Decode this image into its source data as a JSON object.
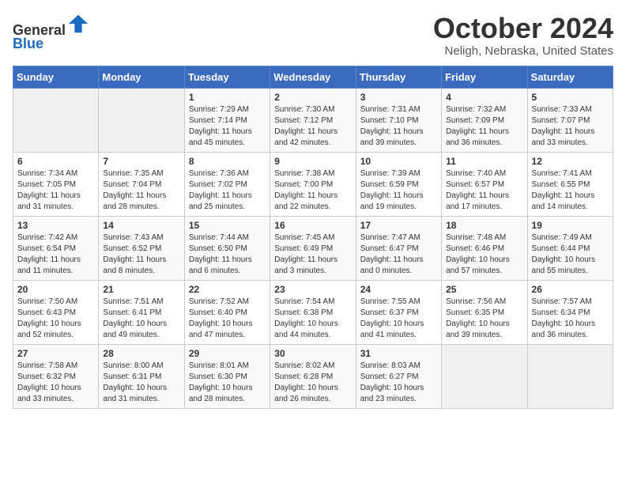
{
  "header": {
    "logo": {
      "line1": "General",
      "line2": "Blue"
    },
    "title": "October 2024",
    "location": "Neligh, Nebraska, United States"
  },
  "weekdays": [
    "Sunday",
    "Monday",
    "Tuesday",
    "Wednesday",
    "Thursday",
    "Friday",
    "Saturday"
  ],
  "weeks": [
    [
      {
        "day": "",
        "empty": true
      },
      {
        "day": "",
        "empty": true
      },
      {
        "day": "1",
        "sunrise": "Sunrise: 7:29 AM",
        "sunset": "Sunset: 7:14 PM",
        "daylight": "Daylight: 11 hours and 45 minutes."
      },
      {
        "day": "2",
        "sunrise": "Sunrise: 7:30 AM",
        "sunset": "Sunset: 7:12 PM",
        "daylight": "Daylight: 11 hours and 42 minutes."
      },
      {
        "day": "3",
        "sunrise": "Sunrise: 7:31 AM",
        "sunset": "Sunset: 7:10 PM",
        "daylight": "Daylight: 11 hours and 39 minutes."
      },
      {
        "day": "4",
        "sunrise": "Sunrise: 7:32 AM",
        "sunset": "Sunset: 7:09 PM",
        "daylight": "Daylight: 11 hours and 36 minutes."
      },
      {
        "day": "5",
        "sunrise": "Sunrise: 7:33 AM",
        "sunset": "Sunset: 7:07 PM",
        "daylight": "Daylight: 11 hours and 33 minutes."
      }
    ],
    [
      {
        "day": "6",
        "sunrise": "Sunrise: 7:34 AM",
        "sunset": "Sunset: 7:05 PM",
        "daylight": "Daylight: 11 hours and 31 minutes."
      },
      {
        "day": "7",
        "sunrise": "Sunrise: 7:35 AM",
        "sunset": "Sunset: 7:04 PM",
        "daylight": "Daylight: 11 hours and 28 minutes."
      },
      {
        "day": "8",
        "sunrise": "Sunrise: 7:36 AM",
        "sunset": "Sunset: 7:02 PM",
        "daylight": "Daylight: 11 hours and 25 minutes."
      },
      {
        "day": "9",
        "sunrise": "Sunrise: 7:38 AM",
        "sunset": "Sunset: 7:00 PM",
        "daylight": "Daylight: 11 hours and 22 minutes."
      },
      {
        "day": "10",
        "sunrise": "Sunrise: 7:39 AM",
        "sunset": "Sunset: 6:59 PM",
        "daylight": "Daylight: 11 hours and 19 minutes."
      },
      {
        "day": "11",
        "sunrise": "Sunrise: 7:40 AM",
        "sunset": "Sunset: 6:57 PM",
        "daylight": "Daylight: 11 hours and 17 minutes."
      },
      {
        "day": "12",
        "sunrise": "Sunrise: 7:41 AM",
        "sunset": "Sunset: 6:55 PM",
        "daylight": "Daylight: 11 hours and 14 minutes."
      }
    ],
    [
      {
        "day": "13",
        "sunrise": "Sunrise: 7:42 AM",
        "sunset": "Sunset: 6:54 PM",
        "daylight": "Daylight: 11 hours and 11 minutes."
      },
      {
        "day": "14",
        "sunrise": "Sunrise: 7:43 AM",
        "sunset": "Sunset: 6:52 PM",
        "daylight": "Daylight: 11 hours and 8 minutes."
      },
      {
        "day": "15",
        "sunrise": "Sunrise: 7:44 AM",
        "sunset": "Sunset: 6:50 PM",
        "daylight": "Daylight: 11 hours and 6 minutes."
      },
      {
        "day": "16",
        "sunrise": "Sunrise: 7:45 AM",
        "sunset": "Sunset: 6:49 PM",
        "daylight": "Daylight: 11 hours and 3 minutes."
      },
      {
        "day": "17",
        "sunrise": "Sunrise: 7:47 AM",
        "sunset": "Sunset: 6:47 PM",
        "daylight": "Daylight: 11 hours and 0 minutes."
      },
      {
        "day": "18",
        "sunrise": "Sunrise: 7:48 AM",
        "sunset": "Sunset: 6:46 PM",
        "daylight": "Daylight: 10 hours and 57 minutes."
      },
      {
        "day": "19",
        "sunrise": "Sunrise: 7:49 AM",
        "sunset": "Sunset: 6:44 PM",
        "daylight": "Daylight: 10 hours and 55 minutes."
      }
    ],
    [
      {
        "day": "20",
        "sunrise": "Sunrise: 7:50 AM",
        "sunset": "Sunset: 6:43 PM",
        "daylight": "Daylight: 10 hours and 52 minutes."
      },
      {
        "day": "21",
        "sunrise": "Sunrise: 7:51 AM",
        "sunset": "Sunset: 6:41 PM",
        "daylight": "Daylight: 10 hours and 49 minutes."
      },
      {
        "day": "22",
        "sunrise": "Sunrise: 7:52 AM",
        "sunset": "Sunset: 6:40 PM",
        "daylight": "Daylight: 10 hours and 47 minutes."
      },
      {
        "day": "23",
        "sunrise": "Sunrise: 7:54 AM",
        "sunset": "Sunset: 6:38 PM",
        "daylight": "Daylight: 10 hours and 44 minutes."
      },
      {
        "day": "24",
        "sunrise": "Sunrise: 7:55 AM",
        "sunset": "Sunset: 6:37 PM",
        "daylight": "Daylight: 10 hours and 41 minutes."
      },
      {
        "day": "25",
        "sunrise": "Sunrise: 7:56 AM",
        "sunset": "Sunset: 6:35 PM",
        "daylight": "Daylight: 10 hours and 39 minutes."
      },
      {
        "day": "26",
        "sunrise": "Sunrise: 7:57 AM",
        "sunset": "Sunset: 6:34 PM",
        "daylight": "Daylight: 10 hours and 36 minutes."
      }
    ],
    [
      {
        "day": "27",
        "sunrise": "Sunrise: 7:58 AM",
        "sunset": "Sunset: 6:32 PM",
        "daylight": "Daylight: 10 hours and 33 minutes."
      },
      {
        "day": "28",
        "sunrise": "Sunrise: 8:00 AM",
        "sunset": "Sunset: 6:31 PM",
        "daylight": "Daylight: 10 hours and 31 minutes."
      },
      {
        "day": "29",
        "sunrise": "Sunrise: 8:01 AM",
        "sunset": "Sunset: 6:30 PM",
        "daylight": "Daylight: 10 hours and 28 minutes."
      },
      {
        "day": "30",
        "sunrise": "Sunrise: 8:02 AM",
        "sunset": "Sunset: 6:28 PM",
        "daylight": "Daylight: 10 hours and 26 minutes."
      },
      {
        "day": "31",
        "sunrise": "Sunrise: 8:03 AM",
        "sunset": "Sunset: 6:27 PM",
        "daylight": "Daylight: 10 hours and 23 minutes."
      },
      {
        "day": "",
        "empty": true
      },
      {
        "day": "",
        "empty": true
      }
    ]
  ]
}
